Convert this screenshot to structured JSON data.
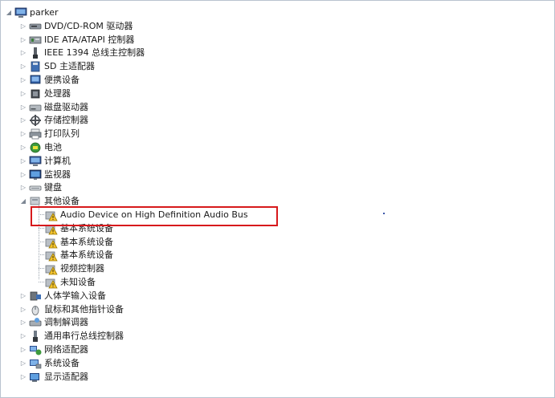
{
  "tree": {
    "root": {
      "label": "parker",
      "icon": "computer-icon"
    },
    "categories": [
      {
        "label": "DVD/CD-ROM 驱动器",
        "icon": "dvd-drive-icon"
      },
      {
        "label": "IDE ATA/ATAPI 控制器",
        "icon": "ide-controller-icon"
      },
      {
        "label": "IEEE 1394 总线主控制器",
        "icon": "ieee1394-icon"
      },
      {
        "label": "SD 主适配器",
        "icon": "sd-adapter-icon"
      },
      {
        "label": "便携设备",
        "icon": "portable-device-icon"
      },
      {
        "label": "处理器",
        "icon": "processor-icon"
      },
      {
        "label": "磁盘驱动器",
        "icon": "disk-drive-icon"
      },
      {
        "label": "存储控制器",
        "icon": "storage-controller-icon"
      },
      {
        "label": "打印队列",
        "icon": "printer-icon"
      },
      {
        "label": "电池",
        "icon": "battery-icon"
      },
      {
        "label": "计算机",
        "icon": "computer-icon"
      },
      {
        "label": "监视器",
        "icon": "monitor-icon"
      },
      {
        "label": "键盘",
        "icon": "keyboard-icon"
      }
    ],
    "other_devices": {
      "label": "其他设备",
      "icon": "unknown-device-icon",
      "children": [
        {
          "label": "Audio Device on High Definition Audio Bus",
          "icon": "warning-device-icon"
        },
        {
          "label": "基本系统设备",
          "icon": "warning-device-icon"
        },
        {
          "label": "基本系统设备",
          "icon": "warning-device-icon"
        },
        {
          "label": "基本系统设备",
          "icon": "warning-device-icon"
        },
        {
          "label": "视频控制器",
          "icon": "warning-device-icon"
        },
        {
          "label": "未知设备",
          "icon": "warning-device-icon"
        }
      ]
    },
    "more_categories": [
      {
        "label": "人体学输入设备",
        "icon": "hid-icon"
      },
      {
        "label": "鼠标和其他指针设备",
        "icon": "mouse-icon"
      },
      {
        "label": "调制解调器",
        "icon": "modem-icon"
      },
      {
        "label": "通用串行总线控制器",
        "icon": "usb-icon"
      },
      {
        "label": "网络适配器",
        "icon": "network-adapter-icon"
      },
      {
        "label": "系统设备",
        "icon": "system-device-icon"
      },
      {
        "label": "显示适配器",
        "icon": "display-adapter-icon"
      }
    ]
  },
  "colors": {
    "highlight_border": "#d7191c",
    "tree_guides": "#9aa3ad",
    "expander": "#7d8794"
  }
}
